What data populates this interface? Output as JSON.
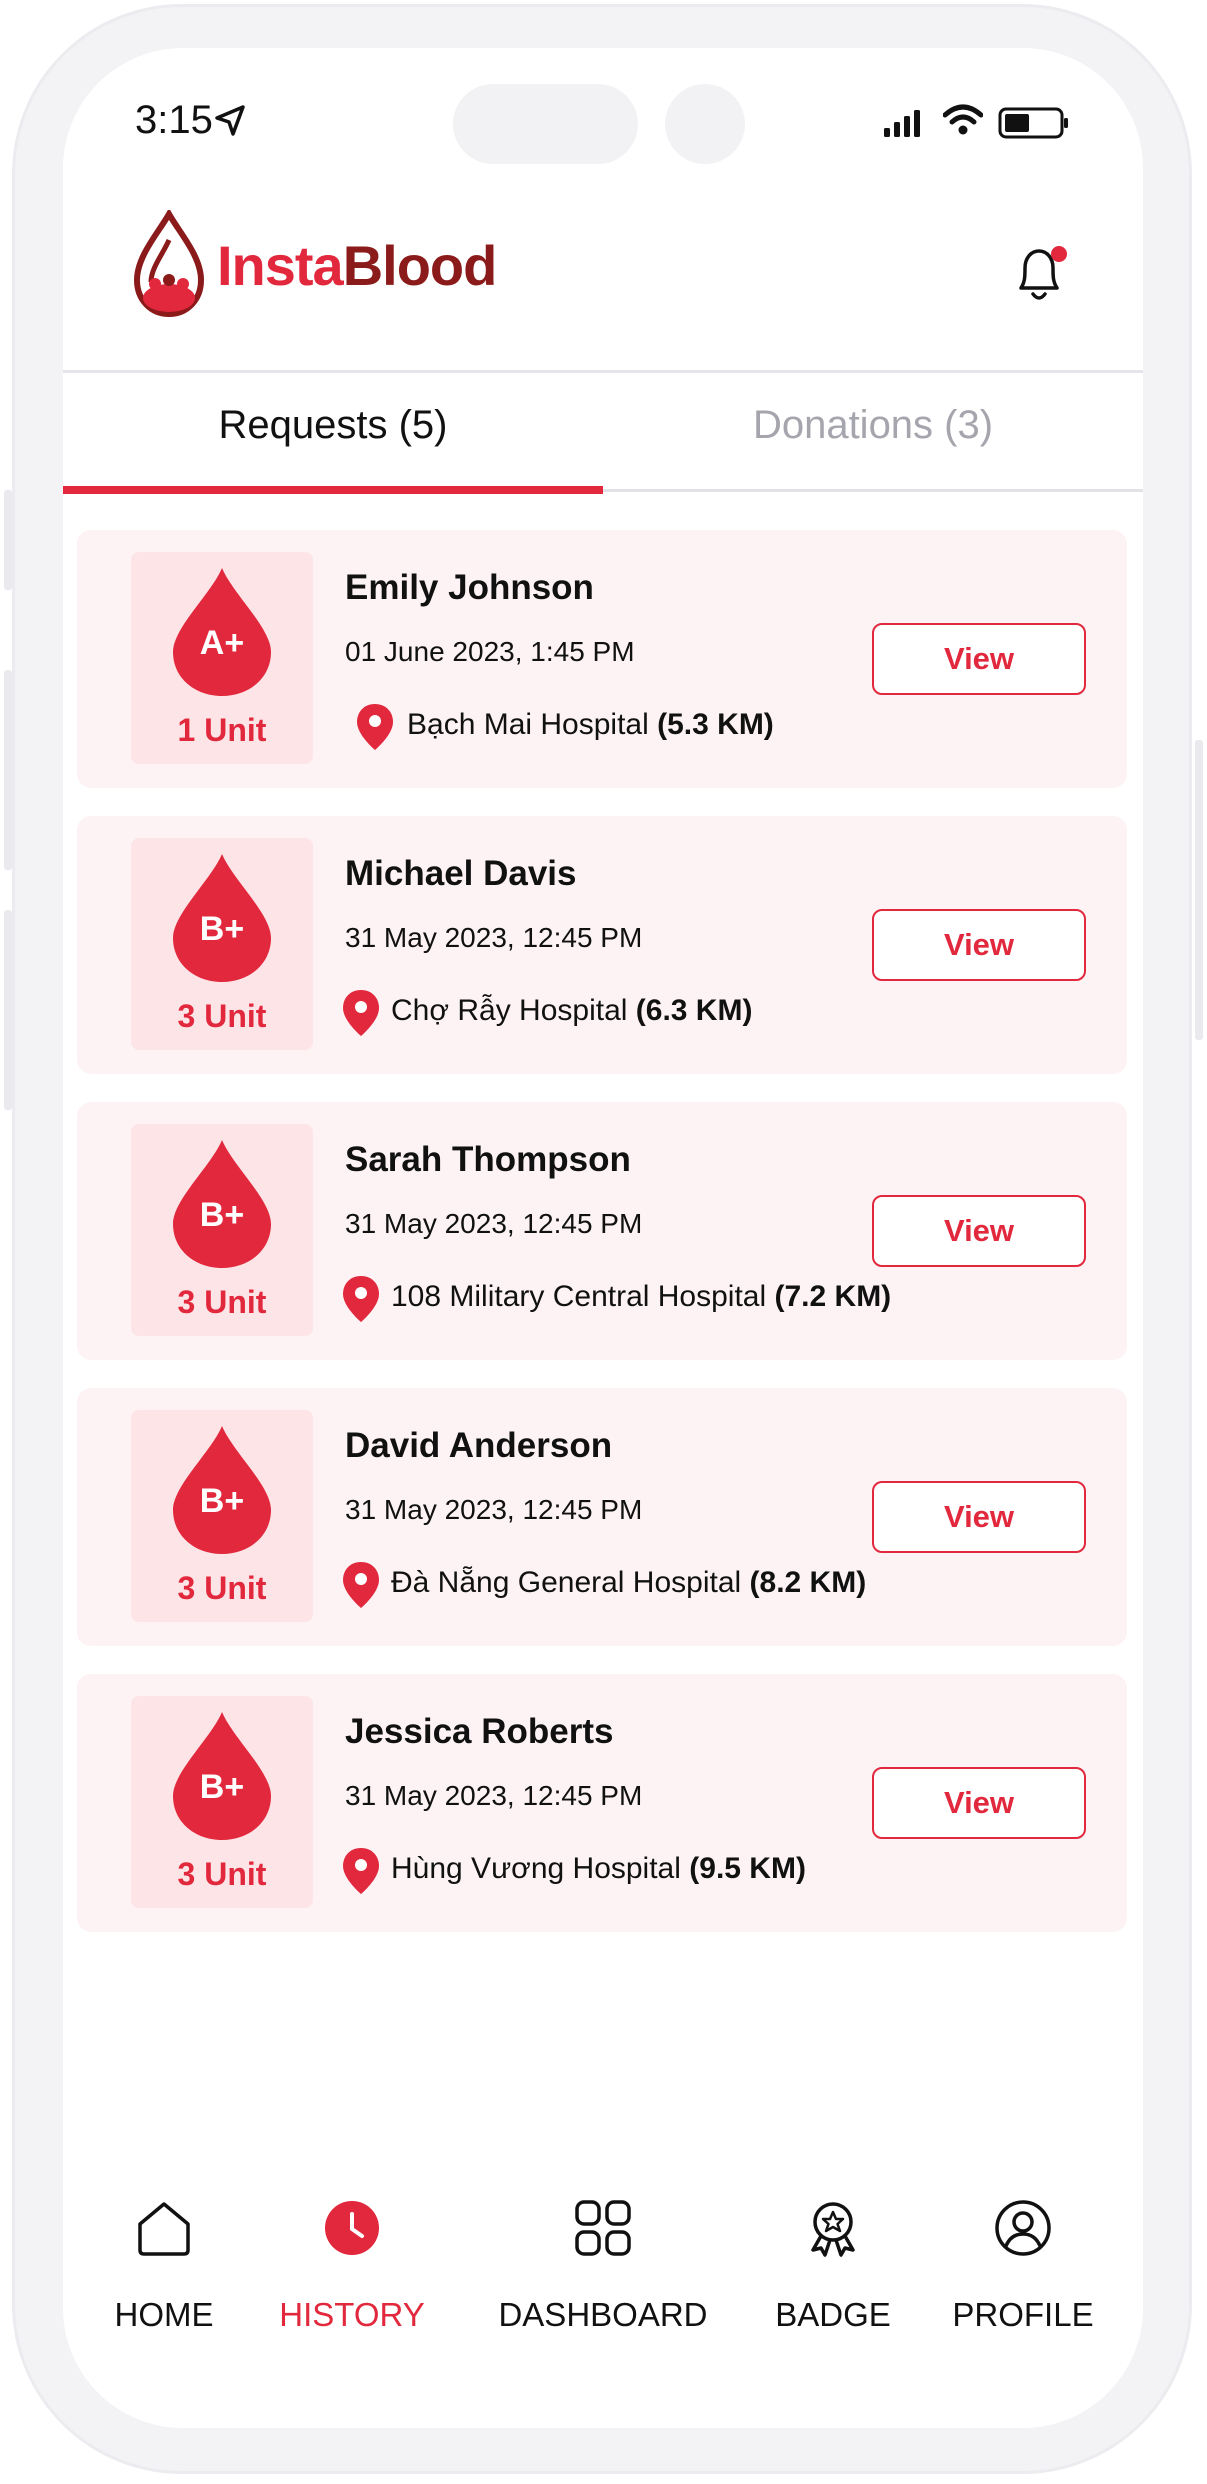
{
  "status_bar": {
    "time": "3:15"
  },
  "app": {
    "logo_part1": "Insta",
    "logo_part2": "Blood"
  },
  "tabs": [
    {
      "label": "Requests (5)",
      "active": true
    },
    {
      "label": "Donations (3)",
      "active": false
    }
  ],
  "requests": [
    {
      "name": "Emily Johnson",
      "datetime": "01 June 2023, 1:45 PM",
      "blood_type": "A+",
      "units": "1 Unit",
      "hospital": "Bạch Mai Hospital",
      "distance": "(5.3 KM)",
      "action": "View"
    },
    {
      "name": "Michael Davis",
      "datetime": "31 May 2023, 12:45 PM",
      "blood_type": "B+",
      "units": "3 Unit",
      "hospital": "Chợ Rẫy Hospital",
      "distance": "(6.3 KM)",
      "action": "View"
    },
    {
      "name": "Sarah Thompson",
      "datetime": "31 May 2023, 12:45 PM",
      "blood_type": "B+",
      "units": "3 Unit",
      "hospital": "108 Military Central Hospital",
      "distance": "(7.2 KM)",
      "action": "View"
    },
    {
      "name": "David Anderson",
      "datetime": "31 May 2023, 12:45 PM",
      "blood_type": "B+",
      "units": "3 Unit",
      "hospital": "Đà Nẵng General Hospital",
      "distance": "(8.2 KM)",
      "action": "View"
    },
    {
      "name": "Jessica Roberts",
      "datetime": "31 May 2023, 12:45 PM",
      "blood_type": "B+",
      "units": "3 Unit",
      "hospital": "Hùng Vương Hospital",
      "distance": "(9.5 KM)",
      "action": "View"
    }
  ],
  "nav": [
    {
      "label": "HOME",
      "icon": "home-icon",
      "active": false
    },
    {
      "label": "HISTORY",
      "icon": "history-icon",
      "active": true
    },
    {
      "label": "DASHBOARD",
      "icon": "dashboard-icon",
      "active": false
    },
    {
      "label": "BADGE",
      "icon": "badge-icon",
      "active": false
    },
    {
      "label": "PROFILE",
      "icon": "profile-icon",
      "active": false
    }
  ],
  "colors": {
    "accent": "#e2283d",
    "brand_dark": "#8b1a1a",
    "card_bg": "#fdf3f4",
    "badge_bg": "#fde4e6"
  }
}
